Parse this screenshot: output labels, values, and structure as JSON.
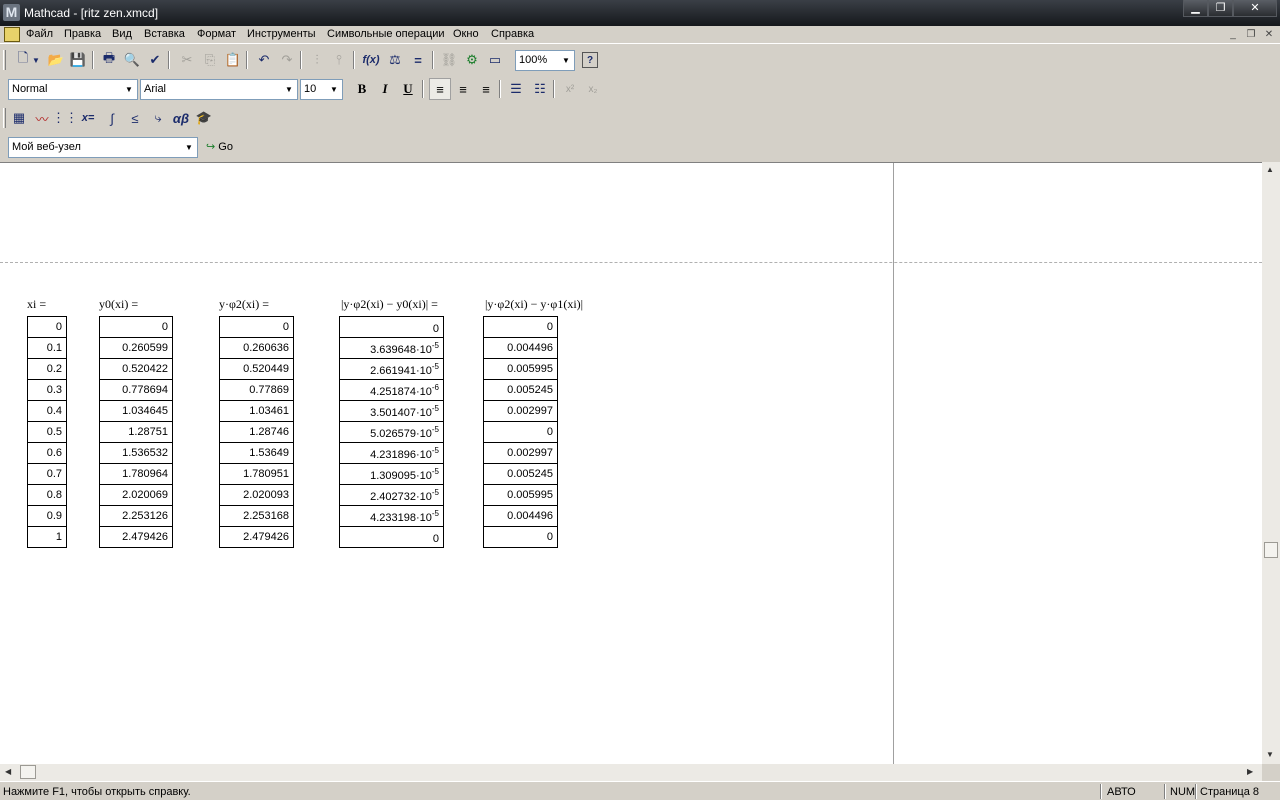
{
  "window": {
    "title": "Mathcad - [ritz  zen.xmcd]",
    "app_icon_letter": "M"
  },
  "menu": {
    "items": [
      "Файл",
      "Правка",
      "Вид",
      "Вставка",
      "Формат",
      "Инструменты",
      "Символьные операции",
      "Окно",
      "Справка"
    ]
  },
  "toolbar_standard": {
    "zoom": "100%",
    "function_label": "f(x)"
  },
  "toolbar_format": {
    "style": "Normal",
    "font": "Arial",
    "size": "10",
    "bold": "B",
    "italic": "I",
    "underline": "U"
  },
  "toolbar_math": {
    "assign": "x=",
    "greek": "αβ"
  },
  "toolbar_web": {
    "url": "Мой веб-узел",
    "go": "Go"
  },
  "worksheet": {
    "headers": {
      "xi": "xi =",
      "y0": "y0(xi) =",
      "yphi2": "y·φ2(xi) =",
      "diff1": "|y·φ2(xi) − y0(xi)| =",
      "diff2": "|y·φ2(xi) − y·φ1(xi)|"
    },
    "xi": [
      "0",
      "0.1",
      "0.2",
      "0.3",
      "0.4",
      "0.5",
      "0.6",
      "0.7",
      "0.8",
      "0.9",
      "1"
    ],
    "y0": [
      "0",
      "0.260599",
      "0.520422",
      "0.778694",
      "1.034645",
      "1.28751",
      "1.536532",
      "1.780964",
      "2.020069",
      "2.253126",
      "2.479426"
    ],
    "yphi2": [
      "0",
      "0.260636",
      "0.520449",
      "0.77869",
      "1.03461",
      "1.28746",
      "1.53649",
      "1.780951",
      "2.020093",
      "2.253168",
      "2.479426"
    ],
    "diff1_mantissa": [
      "0",
      "3.639648·10",
      "2.661941·10",
      "4.251874·10",
      "3.501407·10",
      "5.026579·10",
      "4.231896·10",
      "1.309095·10",
      "2.402732·10",
      "4.233198·10",
      "0"
    ],
    "diff1_exponent": [
      "",
      "-5",
      "-5",
      "-6",
      "-5",
      "-5",
      "-5",
      "-5",
      "-5",
      "-5",
      ""
    ],
    "diff2": [
      "0",
      "0.004496",
      "0.005995",
      "0.005245",
      "0.002997",
      "0",
      "0.002997",
      "0.005245",
      "0.005995",
      "0.004496",
      "0"
    ]
  },
  "status": {
    "hint": "Нажмите F1, чтобы открыть справку.",
    "mode": "АВТО",
    "num": "NUM",
    "page": "Страница 8"
  }
}
